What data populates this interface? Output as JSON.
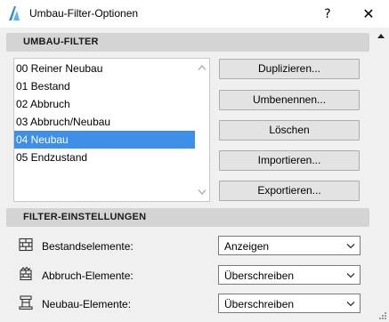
{
  "window": {
    "title": "Umbau-Filter-Optionen",
    "help_label": "?",
    "close_label": "✕"
  },
  "filter_section": {
    "title": "UMBAU-FILTER",
    "items": [
      {
        "label": "00 Reiner Neubau",
        "selected": false
      },
      {
        "label": "01 Bestand",
        "selected": false
      },
      {
        "label": "02 Abbruch",
        "selected": false
      },
      {
        "label": "03 Abbruch/Neubau",
        "selected": false
      },
      {
        "label": "04 Neubau",
        "selected": true
      },
      {
        "label": "05 Endzustand",
        "selected": false
      }
    ],
    "buttons": {
      "duplicate": "Duplizieren...",
      "rename": "Umbenennen...",
      "delete": "Löschen",
      "import": "Importieren...",
      "export": "Exportieren..."
    }
  },
  "settings_section": {
    "title": "FILTER-EINSTELLUNGEN",
    "rows": [
      {
        "label": "Bestandselemente:",
        "value": "Anzeigen"
      },
      {
        "label": "Abbruch-Elemente:",
        "value": "Überschreiben"
      },
      {
        "label": "Neubau-Elemente:",
        "value": "Überschreiben"
      }
    ]
  },
  "colors": {
    "selection": "#3d8fe8",
    "section_header": "#d4d4d4",
    "background": "#f0f0f0"
  }
}
